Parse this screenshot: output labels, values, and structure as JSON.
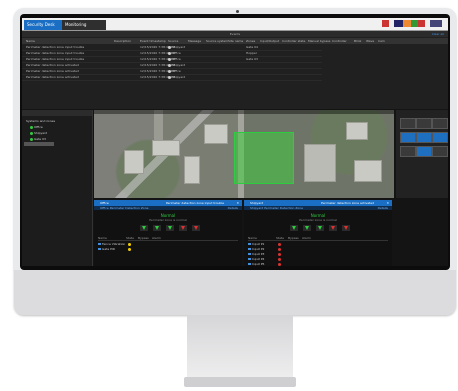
{
  "tabs": [
    {
      "label": "Security Desk"
    },
    {
      "label": "Monitoring"
    }
  ],
  "events": {
    "title": "Events",
    "link": "Clear all",
    "columns": [
      "Name",
      "Description",
      "Event timestamp",
      "Source",
      "Message",
      "Source system",
      "Site name",
      "Zones",
      "Input/Output",
      "Controller state",
      "Manual bypass",
      "Controller",
      "Blink",
      "Wave",
      "Cam"
    ],
    "rows": [
      {
        "name": "Perimeter detection zone input trouble",
        "ts": "12/15/2020 7:38:46 PM",
        "source": "Shipyard",
        "zone": "Gate 04"
      },
      {
        "name": "Perimeter detection zone input trouble",
        "ts": "12/15/2020 7:38:46 PM",
        "source": "Office",
        "zone": "Hopper"
      },
      {
        "name": "Perimeter detection zone input trouble",
        "ts": "12/15/2020 7:38:45 PM",
        "source": "Office",
        "zone": "Gate 03"
      },
      {
        "name": "Perimeter detection zone activated",
        "ts": "12/15/2020 7:38:44 PM",
        "source": "Shipyard",
        "zone": ""
      },
      {
        "name": "Perimeter detection zone activated",
        "ts": "12/15/2020 7:38:43 PM",
        "source": "Office",
        "zone": ""
      },
      {
        "name": "Perimeter detection zone activated",
        "ts": "12/15/2020 7:38:40 PM",
        "source": "Shipyard",
        "zone": ""
      }
    ]
  },
  "tree": {
    "items": [
      "Systems and zones",
      "Office",
      "Shipyard",
      "Gate 03"
    ]
  },
  "cameras": [
    {
      "title": "Office",
      "meta": "Perimeter detection zone input trouble",
      "sub": "Office Perimeter Detection Zone",
      "sub_right": "Details",
      "status": "Normal",
      "status_sub": "Perimeter zone is normal",
      "dev_columns": [
        "Name",
        "State",
        "Bypass",
        "Alarm"
      ],
      "devices": [
        {
          "name": "Fence Vibration",
          "color": "#f2d000"
        },
        {
          "name": "Gate PIR",
          "color": "#f2d000"
        }
      ]
    },
    {
      "title": "Shipyard",
      "meta": "Perimeter detection zone activated",
      "sub": "Shipyard Perimeter Detection Zone",
      "sub_right": "Details",
      "status": "Normal",
      "status_sub": "Perimeter zone is normal",
      "dev_columns": [
        "Name",
        "State",
        "Bypass",
        "Alarm"
      ],
      "devices": [
        {
          "name": "Input P1",
          "color": "#e03030"
        },
        {
          "name": "Input P2",
          "color": "#e03030"
        },
        {
          "name": "Input P3",
          "color": "#e03030"
        },
        {
          "name": "Input P4",
          "color": "#e03030"
        },
        {
          "name": "Input P5",
          "color": "#e03030"
        }
      ]
    }
  ],
  "colors": {
    "accent": "#1a6fc4",
    "normal": "#2ecc40",
    "alarm": "#e03030",
    "trouble": "#f2d000"
  }
}
